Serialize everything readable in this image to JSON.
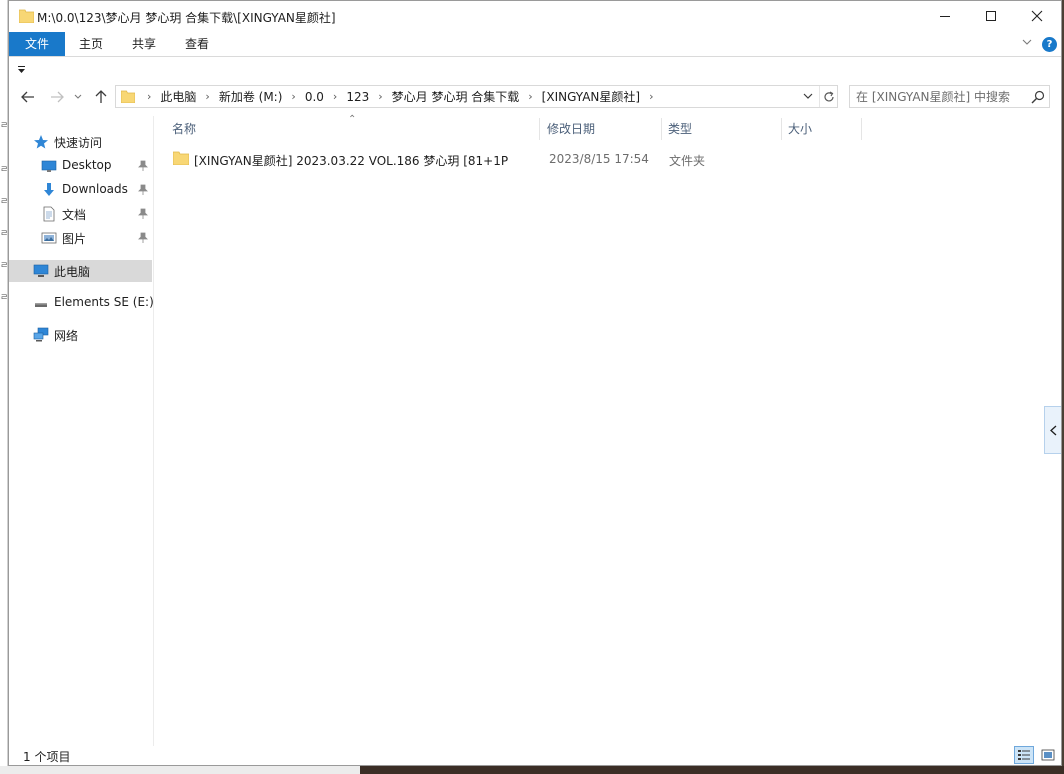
{
  "window": {
    "title": "M:\\0.0\\123\\梦心月 梦心玥 合集下载\\[XINGYAN星颜社]"
  },
  "ribbon": {
    "tabs": [
      {
        "label": "文件"
      },
      {
        "label": "主页"
      },
      {
        "label": "共享"
      },
      {
        "label": "查看"
      }
    ],
    "help_label": "?"
  },
  "address": {
    "crumbs": [
      "此电脑",
      "新加卷 (M:)",
      "0.0",
      "123",
      "梦心月 梦心玥 合集下载",
      "[XINGYAN星颜社]"
    ]
  },
  "search": {
    "placeholder": "在 [XINGYAN星颜社] 中搜索"
  },
  "navpane": {
    "quick_access": "快速访问",
    "items": [
      {
        "label": "Desktop",
        "icon": "desktop-icon",
        "pinned": true
      },
      {
        "label": "Downloads",
        "icon": "downloads-icon",
        "pinned": true
      },
      {
        "label": "文档",
        "icon": "documents-icon",
        "pinned": true
      },
      {
        "label": "图片",
        "icon": "pictures-icon",
        "pinned": true
      }
    ],
    "this_pc": "此电脑",
    "drive": "Elements SE (E:)",
    "network": "网络"
  },
  "columns": {
    "name": "名称",
    "date_modified": "修改日期",
    "type": "类型",
    "size": "大小"
  },
  "files": [
    {
      "name": "[XINGYAN星颜社] 2023.03.22 VOL.186 梦心玥 [81+1P",
      "date_modified": "2023/8/15 17:54",
      "type": "文件夹",
      "size": ""
    }
  ],
  "status": {
    "item_count": "1 个项目"
  },
  "colors": {
    "accent": "#1979ca",
    "folder": "#f8d775",
    "selected_nav": "#d9d9d9",
    "header_text": "#4c607a"
  }
}
